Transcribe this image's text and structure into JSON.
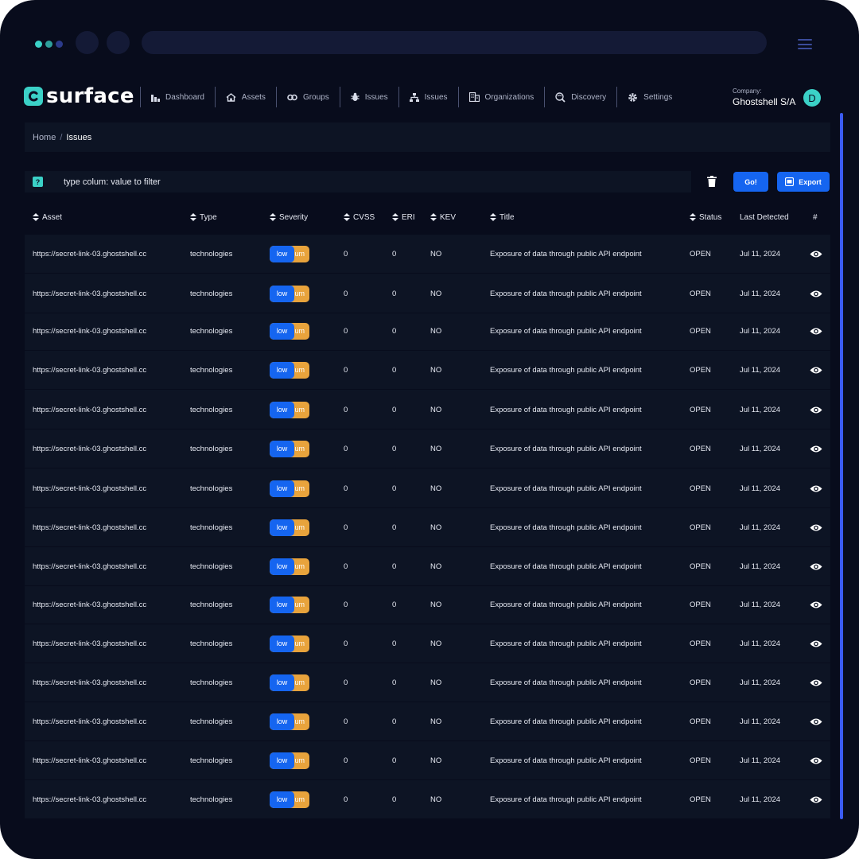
{
  "brand": {
    "name": "surface",
    "accent": "#3bd1c7"
  },
  "nav": [
    {
      "label": "Dashboard",
      "icon": "bar-chart-icon"
    },
    {
      "label": "Assets",
      "icon": "home-icon"
    },
    {
      "label": "Groups",
      "icon": "link-icon"
    },
    {
      "label": "Issues",
      "icon": "bug-icon"
    },
    {
      "label": "Issues",
      "icon": "sitemap-icon"
    },
    {
      "label": "Organizations",
      "icon": "building-icon"
    },
    {
      "label": "Discovery",
      "icon": "search-globe-icon"
    },
    {
      "label": "Settings",
      "icon": "gear-icon"
    }
  ],
  "company": {
    "label": "Company:",
    "name": "Ghostshell S/A",
    "avatar": "D"
  },
  "breadcrumb": {
    "home": "Home",
    "separator": "/",
    "current": "Issues"
  },
  "filter": {
    "help": "?",
    "placeholder": "type colum: value to filter",
    "value": ""
  },
  "actions": {
    "go": "Go!",
    "export": "Export"
  },
  "columns": {
    "asset": "Asset",
    "type": "Type",
    "severity": "Severity",
    "cvss": "CVSS",
    "eri": "ERI",
    "kev": "KEV",
    "title": "Title",
    "status": "Status",
    "last_detected": "Last Detected",
    "actions": "#"
  },
  "rows": [
    {
      "asset": "https://secret-link-03.ghostshell.cc",
      "type": "technologies",
      "severity": "low",
      "severity_hidden": "um",
      "cvss": "0",
      "eri": "0",
      "kev": "NO",
      "title": "Exposure of data through public API endpoint",
      "status": "OPEN",
      "last_detected": "Jul 11, 2024"
    },
    {
      "asset": "https://secret-link-03.ghostshell.cc",
      "type": "technologies",
      "severity": "low",
      "severity_hidden": "um",
      "cvss": "0",
      "eri": "0",
      "kev": "NO",
      "title": "Exposure of data through public API endpoint",
      "status": "OPEN",
      "last_detected": "Jul 11, 2024"
    },
    {
      "asset": "https://secret-link-03.ghostshell.cc",
      "type": "technologies",
      "severity": "low",
      "severity_hidden": "um",
      "cvss": "0",
      "eri": "0",
      "kev": "NO",
      "title": "Exposure of data through public API endpoint",
      "status": "OPEN",
      "last_detected": "Jul 11, 2024"
    },
    {
      "asset": "https://secret-link-03.ghostshell.cc",
      "type": "technologies",
      "severity": "low",
      "severity_hidden": "um",
      "cvss": "0",
      "eri": "0",
      "kev": "NO",
      "title": "Exposure of data through public API endpoint",
      "status": "OPEN",
      "last_detected": "Jul 11, 2024"
    },
    {
      "asset": "https://secret-link-03.ghostshell.cc",
      "type": "technologies",
      "severity": "low",
      "severity_hidden": "um",
      "cvss": "0",
      "eri": "0",
      "kev": "NO",
      "title": "Exposure of data through public API endpoint",
      "status": "OPEN",
      "last_detected": "Jul 11, 2024"
    },
    {
      "asset": "https://secret-link-03.ghostshell.cc",
      "type": "technologies",
      "severity": "low",
      "severity_hidden": "um",
      "cvss": "0",
      "eri": "0",
      "kev": "NO",
      "title": "Exposure of data through public API endpoint",
      "status": "OPEN",
      "last_detected": "Jul 11, 2024"
    },
    {
      "asset": "https://secret-link-03.ghostshell.cc",
      "type": "technologies",
      "severity": "low",
      "severity_hidden": "um",
      "cvss": "0",
      "eri": "0",
      "kev": "NO",
      "title": "Exposure of data through public API endpoint",
      "status": "OPEN",
      "last_detected": "Jul 11, 2024"
    },
    {
      "asset": "https://secret-link-03.ghostshell.cc",
      "type": "technologies",
      "severity": "low",
      "severity_hidden": "um",
      "cvss": "0",
      "eri": "0",
      "kev": "NO",
      "title": "Exposure of data through public API endpoint",
      "status": "OPEN",
      "last_detected": "Jul 11, 2024"
    },
    {
      "asset": "https://secret-link-03.ghostshell.cc",
      "type": "technologies",
      "severity": "low",
      "severity_hidden": "um",
      "cvss": "0",
      "eri": "0",
      "kev": "NO",
      "title": "Exposure of data through public API endpoint",
      "status": "OPEN",
      "last_detected": "Jul 11, 2024"
    },
    {
      "asset": "https://secret-link-03.ghostshell.cc",
      "type": "technologies",
      "severity": "low",
      "severity_hidden": "um",
      "cvss": "0",
      "eri": "0",
      "kev": "NO",
      "title": "Exposure of data through public API endpoint",
      "status": "OPEN",
      "last_detected": "Jul 11, 2024"
    },
    {
      "asset": "https://secret-link-03.ghostshell.cc",
      "type": "technologies",
      "severity": "low",
      "severity_hidden": "um",
      "cvss": "0",
      "eri": "0",
      "kev": "NO",
      "title": "Exposure of data through public API endpoint",
      "status": "OPEN",
      "last_detected": "Jul 11, 2024"
    },
    {
      "asset": "https://secret-link-03.ghostshell.cc",
      "type": "technologies",
      "severity": "low",
      "severity_hidden": "um",
      "cvss": "0",
      "eri": "0",
      "kev": "NO",
      "title": "Exposure of data through public API endpoint",
      "status": "OPEN",
      "last_detected": "Jul 11, 2024"
    },
    {
      "asset": "https://secret-link-03.ghostshell.cc",
      "type": "technologies",
      "severity": "low",
      "severity_hidden": "um",
      "cvss": "0",
      "eri": "0",
      "kev": "NO",
      "title": "Exposure of data through public API endpoint",
      "status": "OPEN",
      "last_detected": "Jul 11, 2024"
    },
    {
      "asset": "https://secret-link-03.ghostshell.cc",
      "type": "technologies",
      "severity": "low",
      "severity_hidden": "um",
      "cvss": "0",
      "eri": "0",
      "kev": "NO",
      "title": "Exposure of data through public API endpoint",
      "status": "OPEN",
      "last_detected": "Jul 11, 2024"
    },
    {
      "asset": "https://secret-link-03.ghostshell.cc",
      "type": "technologies",
      "severity": "low",
      "severity_hidden": "um",
      "cvss": "0",
      "eri": "0",
      "kev": "NO",
      "title": "Exposure of data through public API endpoint",
      "status": "OPEN",
      "last_detected": "Jul 11, 2024"
    }
  ],
  "colors": {
    "background": "#080c1c",
    "panel": "#0d1424",
    "primary": "#1565f0",
    "severity_medium": "#e8a33c",
    "scrollbar": "#3b5bf0"
  }
}
